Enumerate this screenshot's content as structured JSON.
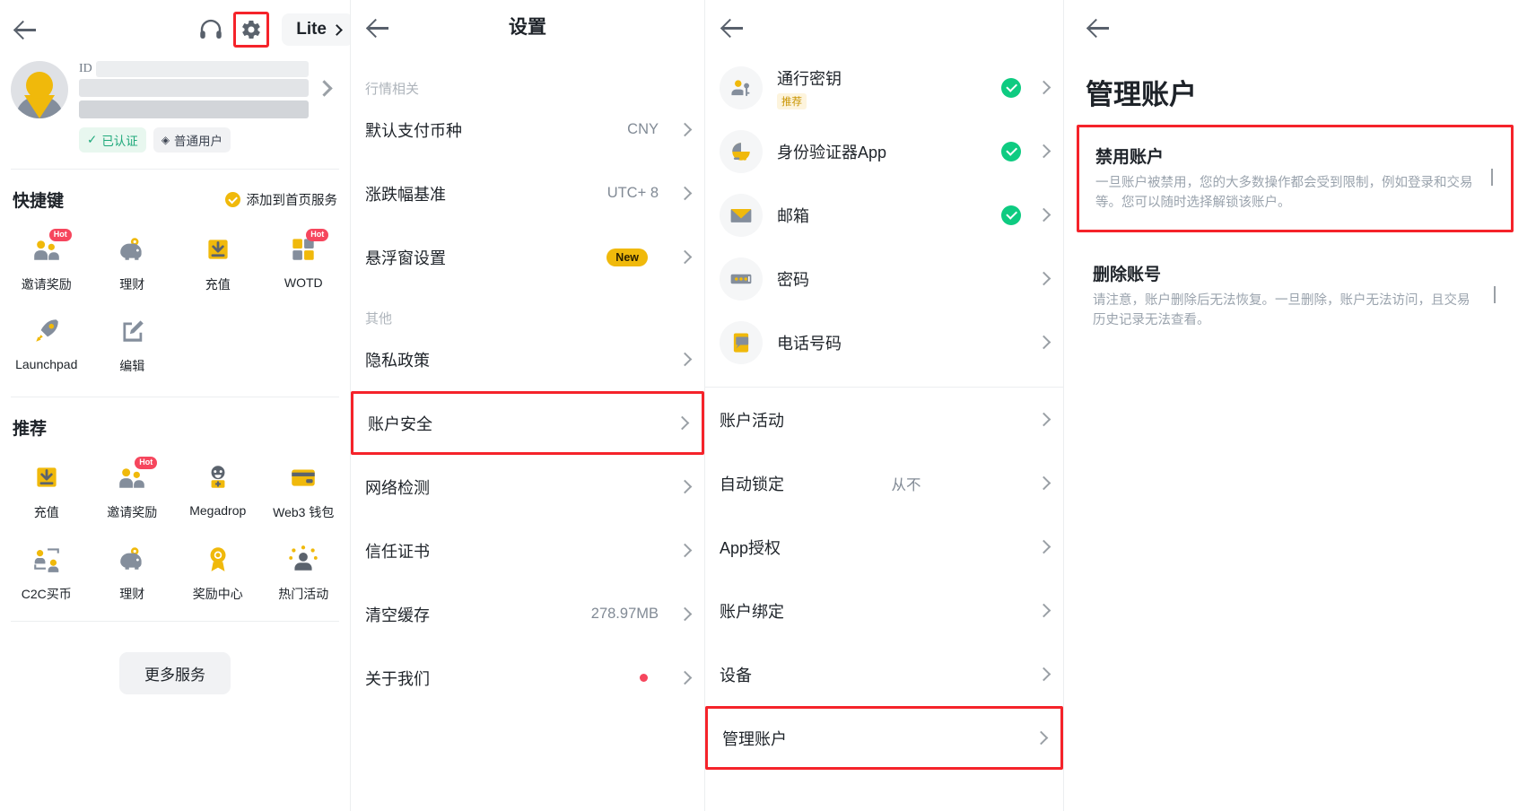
{
  "panel1": {
    "header": {
      "back_icon": "back-arrow-icon",
      "support_icon": "headset-icon",
      "settings_icon": "gear-icon",
      "mode_label": "Lite"
    },
    "profile": {
      "uid_prefix": "ID",
      "badge_verified": "已认证",
      "badge_verified_icon": "check-icon",
      "badge_user_level": "普通用户",
      "badge_user_level_icon": "diamond-icon"
    },
    "shortcuts": {
      "title": "快捷键",
      "action_label": "添加到首页服务",
      "action_icon": "check-circle-icon",
      "items": [
        {
          "label": "邀请奖励",
          "icon": "referral-people-icon",
          "badge": "Hot"
        },
        {
          "label": "理财",
          "icon": "piggy-bank-icon",
          "badge": ""
        },
        {
          "label": "充值",
          "icon": "deposit-download-icon",
          "badge": ""
        },
        {
          "label": "WOTD",
          "icon": "blocks-icon",
          "badge": "Hot"
        },
        {
          "label": "Launchpad",
          "icon": "rocket-icon",
          "badge": ""
        },
        {
          "label": "编辑",
          "icon": "edit-pencil-icon",
          "badge": ""
        }
      ]
    },
    "recommend": {
      "title": "推荐",
      "items": [
        {
          "label": "充值",
          "icon": "deposit-download-icon",
          "badge": ""
        },
        {
          "label": "邀请奖励",
          "icon": "referral-people-icon",
          "badge": "Hot"
        },
        {
          "label": "Megadrop",
          "icon": "megadrop-icon",
          "badge": ""
        },
        {
          "label": "Web3 钱包",
          "icon": "web3-wallet-icon",
          "badge": ""
        },
        {
          "label": "C2C买币",
          "icon": "c2c-trade-icon",
          "badge": ""
        },
        {
          "label": "理财",
          "icon": "piggy-bank-icon",
          "badge": ""
        },
        {
          "label": "奖励中心",
          "icon": "rosette-award-icon",
          "badge": ""
        },
        {
          "label": "热门活动",
          "icon": "hot-campaign-icon",
          "badge": ""
        }
      ]
    },
    "more_services_label": "更多服务"
  },
  "panel2": {
    "title": "设置",
    "back_icon": "back-arrow-icon",
    "group_market": "行情相关",
    "group_other": "其他",
    "rows_market": [
      {
        "label": "默认支付币种",
        "value": "CNY",
        "badge": "",
        "dot": false,
        "highlight": false
      },
      {
        "label": "涨跌幅基准",
        "value": "UTC+ 8",
        "badge": "",
        "dot": false,
        "highlight": false
      },
      {
        "label": "悬浮窗设置",
        "value": "",
        "badge": "New",
        "dot": false,
        "highlight": false
      }
    ],
    "rows_other": [
      {
        "label": "隐私政策",
        "value": "",
        "badge": "",
        "dot": false,
        "highlight": false
      },
      {
        "label": "账户安全",
        "value": "",
        "badge": "",
        "dot": false,
        "highlight": true
      },
      {
        "label": "网络检测",
        "value": "",
        "badge": "",
        "dot": false,
        "highlight": false
      },
      {
        "label": "信任证书",
        "value": "",
        "badge": "",
        "dot": false,
        "highlight": false
      },
      {
        "label": "清空缓存",
        "value": "278.97MB",
        "badge": "",
        "dot": false,
        "highlight": false
      },
      {
        "label": "关于我们",
        "value": "",
        "badge": "",
        "dot": true,
        "highlight": false
      }
    ]
  },
  "panel3": {
    "back_icon": "back-arrow-icon",
    "security_items": [
      {
        "label": "通行密钥",
        "sub": "推荐",
        "icon": "passkey-icon",
        "verified": true
      },
      {
        "label": "身份验证器App",
        "sub": "",
        "icon": "authenticator-icon",
        "verified": true
      },
      {
        "label": "邮箱",
        "sub": "",
        "icon": "email-envelope-icon",
        "verified": true
      },
      {
        "label": "密码",
        "sub": "",
        "icon": "password-dots-icon",
        "verified": false
      },
      {
        "label": "电话号码",
        "sub": "",
        "icon": "phone-sms-icon",
        "verified": false
      }
    ],
    "plain_items": [
      {
        "label": "账户活动",
        "value": "",
        "highlight": false
      },
      {
        "label": "自动锁定",
        "value": "从不",
        "highlight": false
      },
      {
        "label": "App授权",
        "value": "",
        "highlight": false
      },
      {
        "label": "账户绑定",
        "value": "",
        "highlight": false
      },
      {
        "label": "设备",
        "value": "",
        "highlight": false
      },
      {
        "label": "管理账户",
        "value": "",
        "highlight": true
      }
    ]
  },
  "panel4": {
    "back_icon": "back-arrow-icon",
    "title": "管理账户",
    "items": [
      {
        "title": "禁用账户",
        "desc": "一旦账户被禁用，您的大多数操作都会受到限制，例如登录和交易等。您可以随时选择解锁该账户。",
        "highlight": true
      },
      {
        "title": "删除账号",
        "desc": "请注意，账户删除后无法恢复。一旦删除，账户无法访问，且交易历史记录无法查看。",
        "highlight": false
      }
    ]
  },
  "colors": {
    "brand_yellow": "#f0b90b",
    "highlight_red": "#f5232a",
    "success_green": "#0ecb81",
    "text_primary": "#1e2329",
    "text_secondary": "#818a95",
    "hot_red": "#f6465d"
  }
}
